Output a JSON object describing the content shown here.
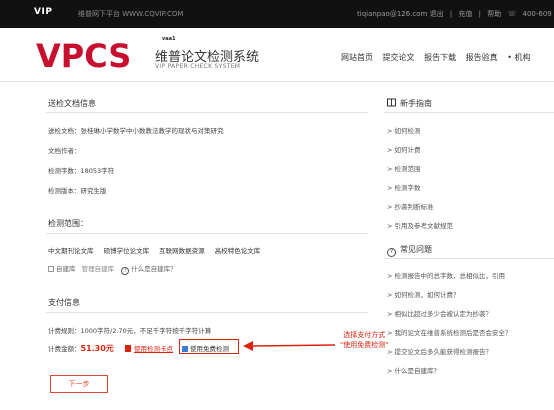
{
  "topbar": {
    "brand": "VIP",
    "url_text": "维普网下平台 WWW.CQVIP.COM",
    "account": "tiqianpao@126.com 退出",
    "recharge": "充值",
    "help": "帮助",
    "phone": "400-609"
  },
  "header": {
    "logo_text": "VPCS",
    "logo_tag": "vaa1",
    "title": "维普论文检测系统",
    "subtitle": "VIP PAPER CHECK SYSTEM",
    "nav": [
      "网站首页",
      "提交论文",
      "报告下载",
      "报告验真",
      "• 机构"
    ]
  },
  "doc_info": {
    "title": "送检文档信息",
    "doc_title": "送检文档：张桂琳小学数学中小数教法教学的现状与对策研究",
    "author": "文档作者：",
    "word_count": "检测字数：18053字符",
    "version": "检测版本：研究生版"
  },
  "range": {
    "title": "检测范围：",
    "tabs": [
      "中文期刊论文库",
      "硕博学位论文库",
      "互联网数据资源",
      "高校特色论文库"
    ],
    "self_db": "自建库",
    "manage_self_db": "管理自建库",
    "what_is_self_db": "什么是自建库？"
  },
  "payment": {
    "title": "支付信息",
    "rule": "计费规则：1000字符/2.70元，不足千字符按千字符计算",
    "amount_label": "计费金额：",
    "amount": "51.30元",
    "card_option": "使用检测卡点",
    "free_option": "使用免费检测",
    "next": "下一步"
  },
  "annotation": {
    "line1": "选择支付方式",
    "line2": "\"使用免费检测\""
  },
  "sidebar": {
    "guide_title": "新手指南",
    "guide_items": [
      "> 如何检测",
      "> 如何计费",
      "> 检测范围",
      "> 检测字数",
      "> 抄袭判断标准",
      "> 引用及参考文献规范"
    ],
    "faq_title": "常见问题",
    "faq_items": [
      "> 检测报告中的总字数，总相似比，引用",
      "> 如何检测，如何计费？",
      "> 相似比超过多少会被认定为抄袭？",
      "> 我的论文在维普系统检测后是否会安全？",
      "> 提交论文后多久能获得检测报告？",
      "> 什么是自建库？"
    ]
  },
  "colors": {
    "accent": "#d9230f",
    "logo_red": "#c8102e"
  }
}
